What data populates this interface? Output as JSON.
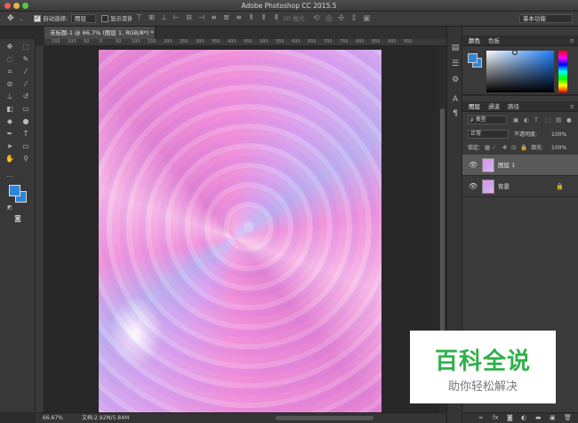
{
  "window": {
    "title": "Adobe Photoshop CC 2015.5"
  },
  "options_bar": {
    "auto_select_label": "自动选择:",
    "auto_select_value": "图层",
    "show_transform_label": "显示变换控件",
    "mode_3d_label": "3D 模式:",
    "workspace": "基本功能"
  },
  "document": {
    "tab_title": "未标题-1 @ 66.7% (图层 1, RGB/8*) *",
    "ruler_ticks": [
      "150",
      "100",
      "50",
      "0",
      "50",
      "100",
      "150",
      "200",
      "250",
      "300",
      "350",
      "400",
      "450",
      "500",
      "550",
      "600",
      "650",
      "700",
      "750",
      "800",
      "850",
      "900",
      "950"
    ]
  },
  "status": {
    "zoom": "66.67%",
    "doc_info": "文档:2.92M/5.84M"
  },
  "color_panel": {
    "tabs": [
      "颜色",
      "色板"
    ],
    "fg_color": "#2f86d4",
    "bg_color": "#2f86d4"
  },
  "layers_panel": {
    "tabs": [
      "图层",
      "通道",
      "路径"
    ],
    "filter_label": "ρ 类型",
    "blend_mode": "正常",
    "opacity_label": "不透明度:",
    "opacity_value": "100%",
    "lock_label": "锁定:",
    "fill_label": "填充:",
    "fill_value": "100%",
    "layers": [
      {
        "name": "图层 1",
        "selected": true
      },
      {
        "name": "背景",
        "selected": false,
        "locked": true
      }
    ]
  },
  "watermark": {
    "title": "百科全说",
    "subtitle": "助你轻松解决"
  }
}
